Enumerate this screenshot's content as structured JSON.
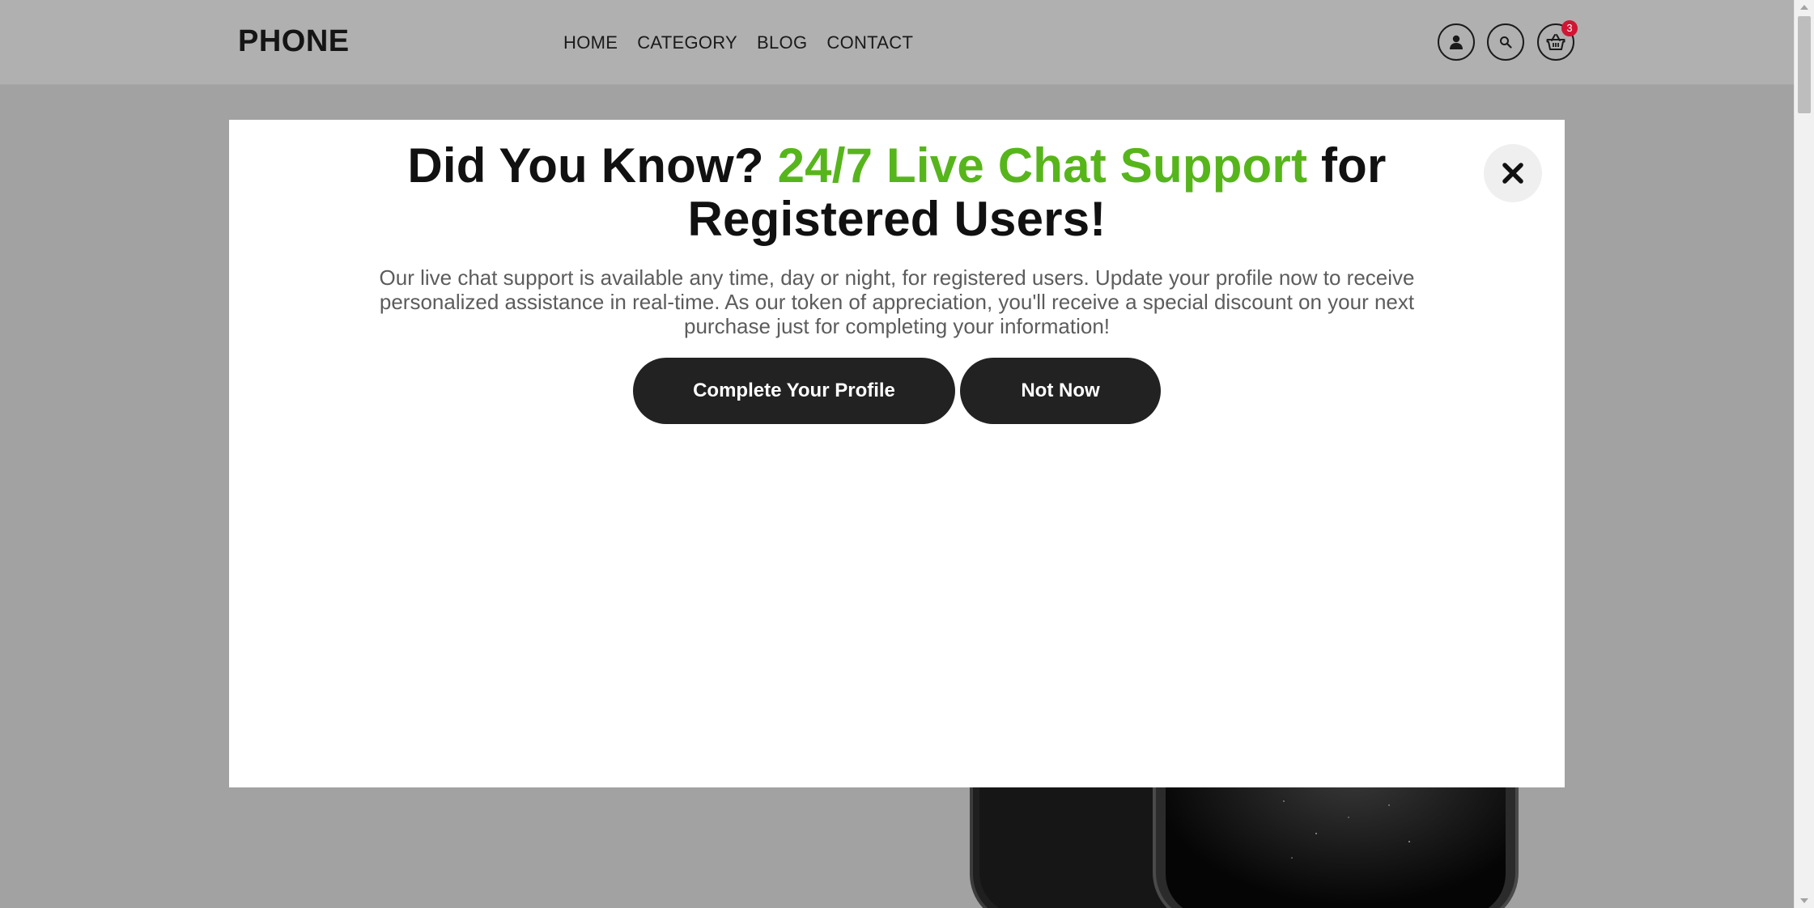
{
  "header": {
    "logo": "PHONE",
    "nav": [
      "HOME",
      "CATEGORY",
      "BLOG",
      "CONTACT"
    ],
    "cart_count": "3",
    "icons": [
      "user-icon",
      "search-icon",
      "basket-icon"
    ]
  },
  "modal": {
    "title_prefix": "Did You Know?",
    "title_accent": "24/7 Live Chat Support",
    "title_suffix": "for Registered Users!",
    "body": "Our live chat support is available any time, day or night, for registered users. Update your profile now to receive personalized assistance in real-time. As our token of appreciation, you'll receive a special discount on your next purchase just for completing your information!",
    "primary_button": "Complete Your Profile",
    "secondary_button": "Not Now",
    "close_icon": "close-icon"
  },
  "colors": {
    "accent": "#57b51c",
    "button_bg": "#222222",
    "badge": "#d01633",
    "overlay": "#a2a2a2"
  }
}
